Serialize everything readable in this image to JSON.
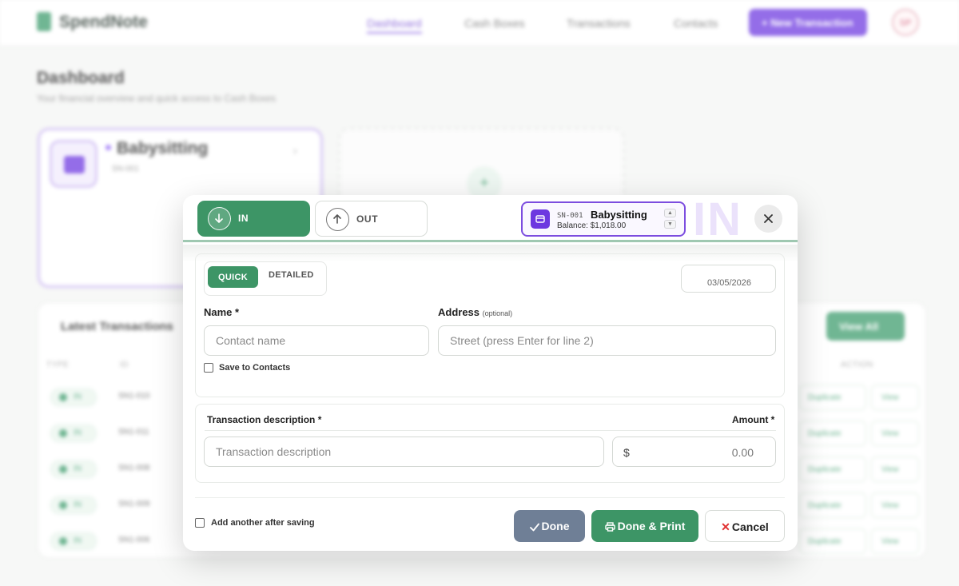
{
  "background": {
    "app_name": "SpendNote",
    "nav": [
      "Dashboard",
      "Cash Boxes",
      "Transactions",
      "Contacts"
    ],
    "new_tx_label": "+ New Transaction",
    "avatar_initials": "SP",
    "page_title": "Dashboard",
    "page_subtitle": "Your financial overview and quick access to Cash Boxes",
    "box_card": {
      "name": "Babysitting",
      "id": "SN-001"
    },
    "latest": {
      "title": "Latest Transactions",
      "view_all": "View All",
      "columns": [
        "TYPE",
        "ID",
        "ACTION"
      ],
      "rows": [
        {
          "type": "IN",
          "id": "SN1-010",
          "duplicate": "Duplicate",
          "view": "View"
        },
        {
          "type": "IN",
          "id": "SN1-011",
          "duplicate": "Duplicate",
          "view": "View"
        },
        {
          "type": "IN",
          "id": "SN1-008",
          "duplicate": "Duplicate",
          "view": "View"
        },
        {
          "type": "IN",
          "id": "SN1-009",
          "duplicate": "Duplicate",
          "view": "View"
        },
        {
          "type": "IN",
          "id": "SN1-006",
          "duplicate": "Duplicate",
          "view": "View"
        }
      ]
    }
  },
  "modal": {
    "direction": {
      "in_label": "IN",
      "out_label": "OUT",
      "selected": "IN"
    },
    "cash_box": {
      "id": "SN-001",
      "name": "Babysitting",
      "balance": "Balance: $1,018.00"
    },
    "watermark": "IN",
    "mode": {
      "quick": "QUICK",
      "detailed": "DETAILED",
      "selected": "QUICK"
    },
    "date": "03/05/2026",
    "name_label": "Name *",
    "name_placeholder": "Contact name",
    "address_label": "Address",
    "address_optional": "(optional)",
    "address_placeholder": "Street (press Enter for line 2)",
    "save_contacts_label": "Save to Contacts",
    "description_label": "Transaction description *",
    "amount_label": "Amount *",
    "description_placeholder": "Transaction description",
    "currency_symbol": "$",
    "amount_placeholder": "0.00",
    "add_another_label": "Add another after saving",
    "buttons": {
      "done": "Done",
      "done_print": "Done & Print",
      "cancel": "Cancel"
    }
  },
  "colors": {
    "accent_green": "#3d9566",
    "accent_purple": "#6d38e0",
    "done_gray": "#6f7f96"
  }
}
